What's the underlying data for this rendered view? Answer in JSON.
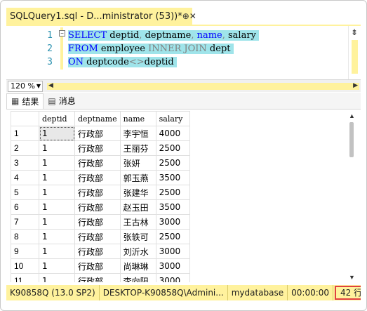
{
  "tab": {
    "title": "SQLQuery1.sql - D...ministrator (53))*",
    "pin_icon": "pin-icon",
    "close_icon": "close-icon"
  },
  "editor": {
    "line_numbers": [
      "1",
      "2",
      "3"
    ],
    "lines": [
      [
        {
          "t": "SELECT",
          "c": "kw"
        },
        {
          "t": " deptid",
          "c": "blk"
        },
        {
          "t": ",",
          "c": "gray"
        },
        {
          "t": " deptname",
          "c": "blk"
        },
        {
          "t": ",",
          "c": "gray"
        },
        {
          "t": " name",
          "c": "kw"
        },
        {
          "t": ",",
          "c": "gray"
        },
        {
          "t": " salary",
          "c": "blk"
        }
      ],
      [
        {
          "t": "FROM",
          "c": "kw"
        },
        {
          "t": " employee ",
          "c": "blk"
        },
        {
          "t": "INNER JOIN",
          "c": "gray"
        },
        {
          "t": " dept",
          "c": "blk"
        }
      ],
      [
        {
          "t": "ON",
          "c": "kw"
        },
        {
          "t": " deptcode",
          "c": "blk"
        },
        {
          "t": "<>",
          "c": "gray"
        },
        {
          "t": "deptid",
          "c": "blk"
        }
      ]
    ],
    "collapse_glyph": "−",
    "split_glyph": "⇟"
  },
  "zoom": {
    "value": "120 %"
  },
  "results_tabs": [
    {
      "label": "结果",
      "icon": "grid-icon"
    },
    {
      "label": "消息",
      "icon": "messages-icon"
    }
  ],
  "grid": {
    "columns": [
      "",
      "deptid",
      "deptname",
      "name",
      "salary"
    ],
    "rows": [
      [
        "1",
        "1",
        "行政部",
        "李宇恒",
        "4000"
      ],
      [
        "2",
        "1",
        "行政部",
        "王丽芬",
        "2500"
      ],
      [
        "3",
        "1",
        "行政部",
        "张妍",
        "2500"
      ],
      [
        "4",
        "1",
        "行政部",
        "郭玉燕",
        "3500"
      ],
      [
        "5",
        "1",
        "行政部",
        "张建华",
        "2500"
      ],
      [
        "6",
        "1",
        "行政部",
        "赵玉田",
        "3500"
      ],
      [
        "7",
        "1",
        "行政部",
        "王古林",
        "3000"
      ],
      [
        "8",
        "1",
        "行政部",
        "张轶可",
        "2500"
      ],
      [
        "9",
        "1",
        "行政部",
        "刘沂水",
        "3000"
      ],
      [
        "10",
        "1",
        "行政部",
        "尚琳琳",
        "3000"
      ],
      [
        "11",
        "1",
        "行政部",
        "李向阳",
        "3000"
      ]
    ]
  },
  "status": {
    "server": "K90858Q (13.0 SP2)",
    "user": "DESKTOP-K90858Q\\Admini...",
    "database": "mydatabase",
    "time": "00:00:00",
    "rows": "42 行"
  },
  "colors": {
    "accent": "#fff29d",
    "keyword": "#0000ff",
    "selection": "#9fe4ea",
    "highlight_border": "#e04040"
  }
}
